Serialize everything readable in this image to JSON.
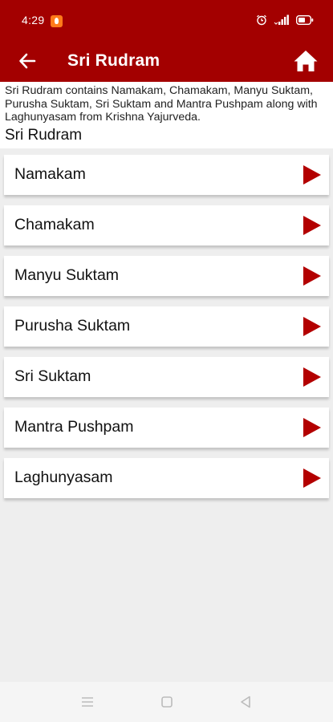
{
  "status_bar": {
    "time": "4:29",
    "notification_icon": "flame-notification-icon",
    "icons": [
      "alarm-icon",
      "signal-icon",
      "battery-icon"
    ]
  },
  "app_bar": {
    "title": "Sri Rudram",
    "back_icon": "arrow-left-icon",
    "home_icon": "home-icon",
    "color": "#a30000"
  },
  "intro": {
    "text": "Sri Rudram contains Namakam, Chamakam, Manyu Suktam, Purusha Suktam, Sri Suktam and Mantra Pushpam along with Laghunyasam from Krishna Yajurveda.",
    "heading": "Sri Rudram"
  },
  "items": [
    {
      "label": "Namakam",
      "icon": "play-icon"
    },
    {
      "label": "Chamakam",
      "icon": "play-icon"
    },
    {
      "label": "Manyu Suktam",
      "icon": "play-icon"
    },
    {
      "label": "Purusha Suktam",
      "icon": "play-icon"
    },
    {
      "label": "Sri Suktam",
      "icon": "play-icon"
    },
    {
      "label": "Mantra Pushpam",
      "icon": "play-icon"
    },
    {
      "label": "Laghunyasam",
      "icon": "play-icon"
    }
  ],
  "colors": {
    "accent": "#a30000",
    "play_icon": "#b30000",
    "background": "#eeeeee"
  },
  "nav_bar": {
    "buttons": [
      "menu-icon",
      "home-square-icon",
      "back-triangle-icon"
    ]
  }
}
